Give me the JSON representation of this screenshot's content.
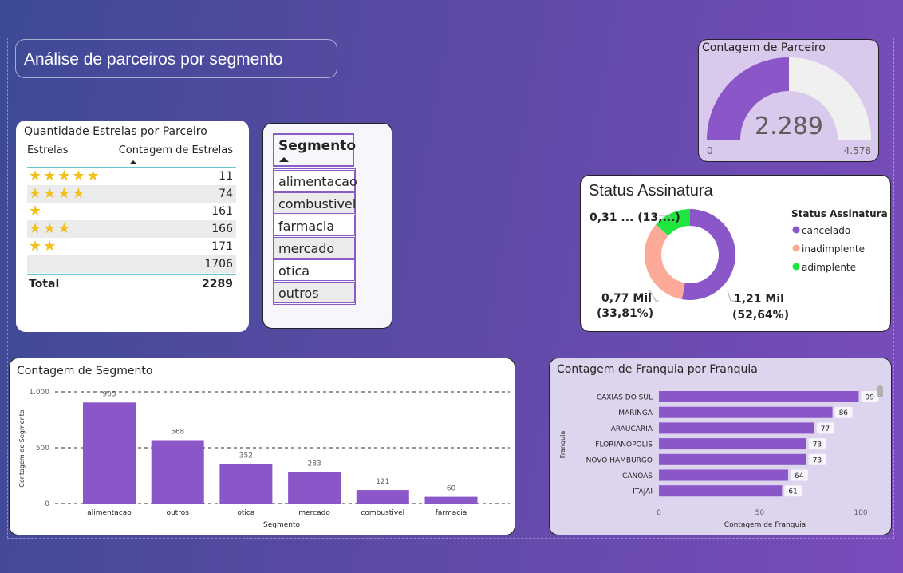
{
  "page": {
    "title": "Análise de parceiros por segmento"
  },
  "stars_table": {
    "title": "Quantidade Estrelas por Parceiro",
    "col1": "Estrelas",
    "col2": "Contagem de Estrelas",
    "rows": [
      {
        "stars": 5,
        "stars_text": "★★★★★",
        "value": "11"
      },
      {
        "stars": 4,
        "stars_text": "★★★★",
        "value": "74"
      },
      {
        "stars": 1,
        "stars_text": "★",
        "value": "161"
      },
      {
        "stars": 3,
        "stars_text": "★★★",
        "value": "166"
      },
      {
        "stars": 2,
        "stars_text": "★★",
        "value": "171"
      },
      {
        "stars": 0,
        "stars_text": "",
        "value": "1706"
      }
    ],
    "total_label": "Total",
    "total_value": "2289"
  },
  "slicer": {
    "title": "Segmento",
    "items": [
      "alimentacao",
      "combustivel",
      "farmacia",
      "mercado",
      "otica",
      "outros"
    ]
  },
  "colors": {
    "accent": "#8a56c8",
    "salmon": "#fca998",
    "green": "#1ee63e",
    "gauge_track": "#f0f0f0"
  },
  "chart_data": [
    {
      "type": "gauge",
      "title": "Contagem de Parceiro",
      "value": 2289,
      "value_label": "2.289",
      "min": 0,
      "min_label": "0",
      "max": 4578,
      "max_label": "4.578"
    },
    {
      "type": "pie",
      "title": "Status Assinatura",
      "legend_title": "Status Assinatura",
      "legend_position": "right",
      "categories": [
        "cancelado",
        "inadimplente",
        "adimplente"
      ],
      "values": [
        1210,
        770,
        310
      ],
      "percents": [
        52.64,
        33.81,
        13.55
      ],
      "labels": [
        {
          "line1": "1,21 Mil",
          "line2": "(52,64%)"
        },
        {
          "line1": "0,77 Mil",
          "line2": "(33,81%)"
        },
        {
          "line1": "0,31 ... (13,...)",
          "line2": ""
        }
      ]
    },
    {
      "type": "bar",
      "title": "Contagem de Segmento",
      "xlabel": "Segmento",
      "ylabel": "Contagem de Segmento",
      "categories": [
        "alimentacao",
        "outros",
        "otica",
        "mercado",
        "combustivel",
        "farmacia"
      ],
      "values": [
        905,
        568,
        352,
        283,
        121,
        60
      ],
      "ylim": [
        0,
        1000
      ],
      "yticks": [
        0,
        500,
        1000
      ],
      "ytick_labels": [
        "0",
        "500",
        "1.000"
      ],
      "grid": true
    },
    {
      "type": "bar",
      "orientation": "horizontal",
      "title": "Contagem de Franquia por Franquia",
      "xlabel": "Contagem de Franquia",
      "ylabel": "Franquia",
      "categories": [
        "CAXIAS DO SUL",
        "MARINGA",
        "ARAUCARIA",
        "FLORIANOPOLIS",
        "NOVO HAMBURGO",
        "CANOAS",
        "ITAJAI"
      ],
      "values": [
        99,
        86,
        77,
        73,
        73,
        64,
        61
      ],
      "xlim": [
        0,
        100
      ],
      "xticks": [
        0,
        50,
        100
      ]
    }
  ]
}
